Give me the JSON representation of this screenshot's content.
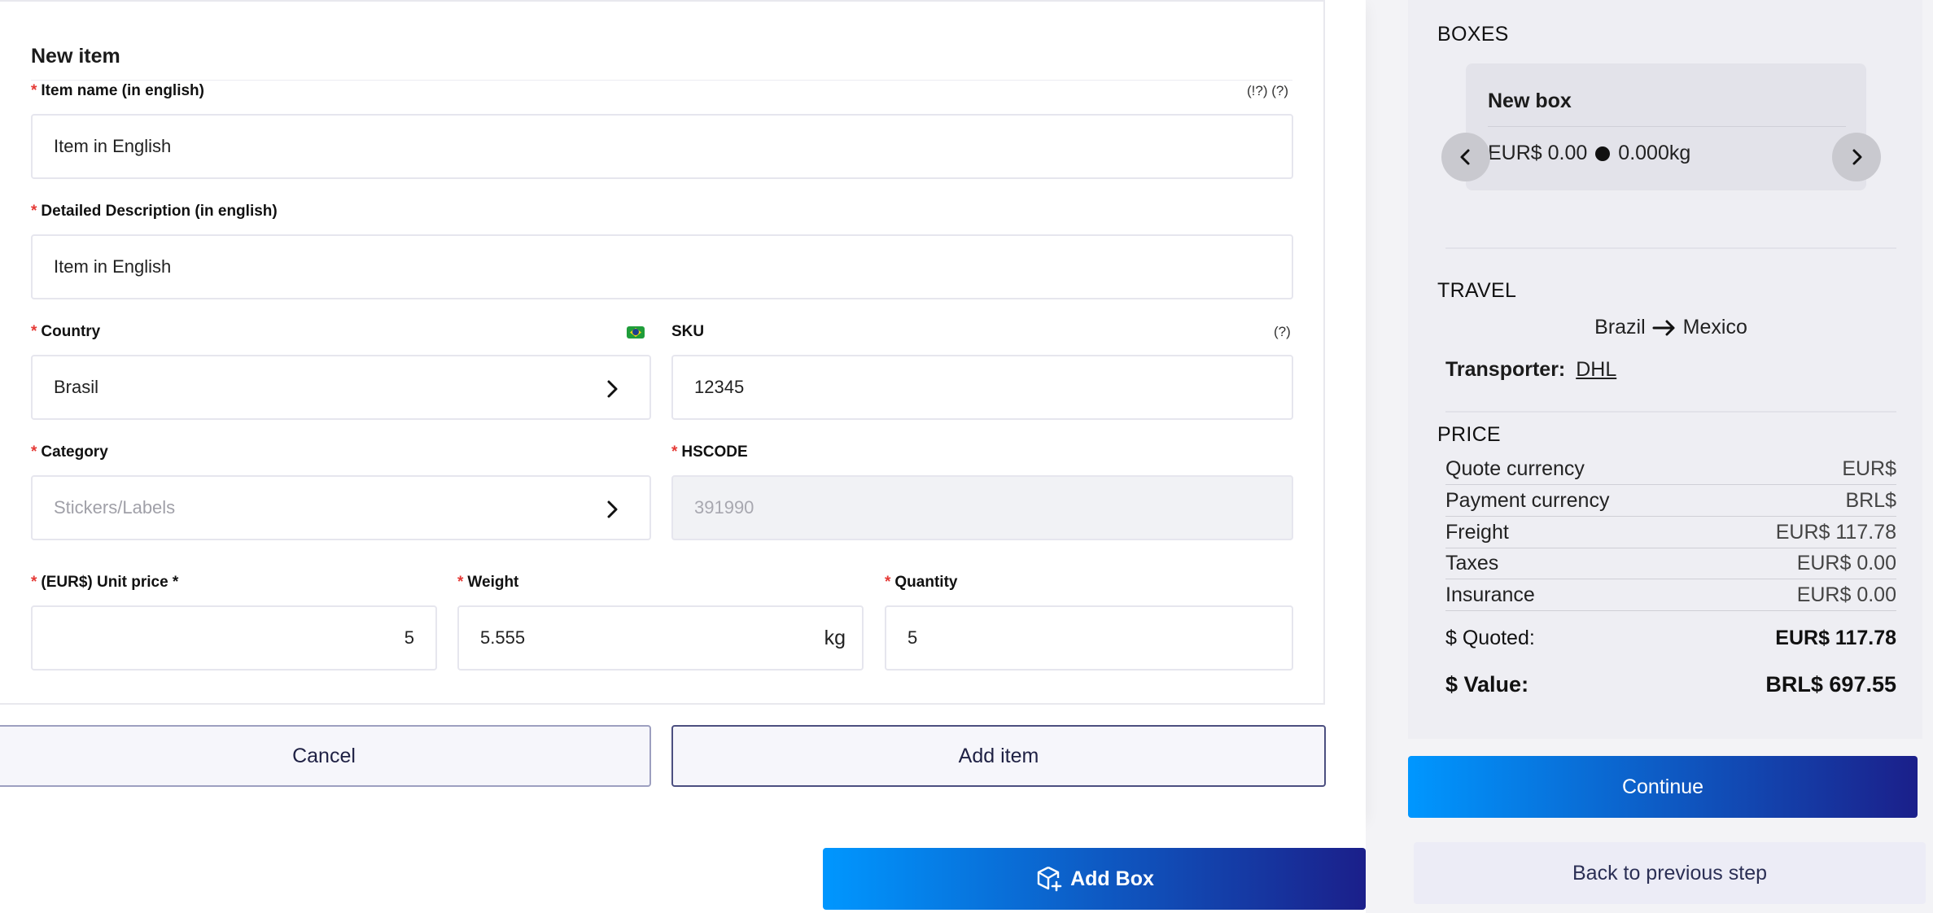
{
  "form": {
    "title": "New item",
    "item_name": {
      "label": "Item name (in english)",
      "hint": "(!?) (?)",
      "value": "Item in English"
    },
    "description": {
      "label": "Detailed Description (in english)",
      "value": "Item in English"
    },
    "country": {
      "label": "Country",
      "value": "Brasil"
    },
    "sku": {
      "label": "SKU",
      "hint": "(?)",
      "value": "12345"
    },
    "category": {
      "label": "Category",
      "placeholder": "Stickers/Labels"
    },
    "hscode": {
      "label": "HSCODE",
      "placeholder": "391990"
    },
    "unit_price": {
      "label": "(EUR$) Unit price *",
      "value": "5"
    },
    "weight": {
      "label": "Weight",
      "value": "5.555",
      "unit": "kg"
    },
    "quantity": {
      "label": "Quantity",
      "value": "5"
    },
    "required_mark": "*",
    "cancel_label": "Cancel",
    "add_item_label": "Add item"
  },
  "add_box_label": "Add Box",
  "summary": {
    "boxes_heading": "BOXES",
    "box": {
      "title": "New box",
      "price": "EUR$ 0.00",
      "weight": "0.000kg"
    },
    "travel_heading": "TRAVEL",
    "origin": "Brazil",
    "destination": "Mexico",
    "transporter_label": "Transporter:",
    "transporter": "DHL",
    "price_heading": "PRICE",
    "price_rows": [
      {
        "label": "Quote currency",
        "value": "EUR$"
      },
      {
        "label": "Payment currency",
        "value": "BRL$"
      },
      {
        "label": "Freight",
        "value": "EUR$ 117.78"
      },
      {
        "label": "Taxes",
        "value": "EUR$ 0.00"
      },
      {
        "label": "Insurance",
        "value": "EUR$ 0.00"
      }
    ],
    "quoted": {
      "label": "$ Quoted:",
      "value": "EUR$ 117.78"
    },
    "total": {
      "label": "$ Value:",
      "value": "BRL$ 697.55"
    }
  },
  "continue_label": "Continue",
  "back_label": "Back to previous step",
  "colors": {
    "accent_start": "#0097ff",
    "accent_end": "#1b1f8a",
    "required": "#e53935",
    "brazil_flag": "#1f9d3a"
  }
}
